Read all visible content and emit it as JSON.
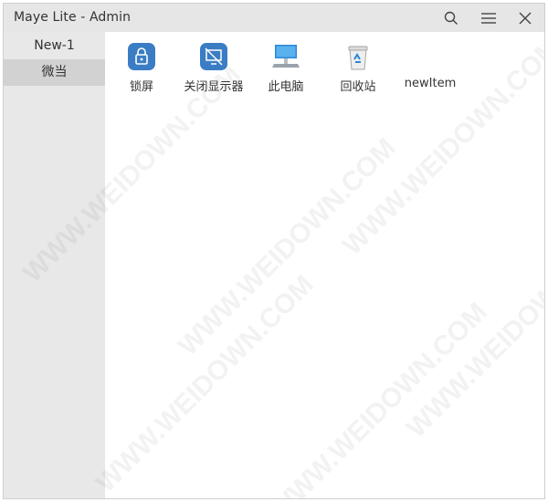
{
  "window": {
    "title": "Maye Lite - Admin"
  },
  "titlebar": {
    "icons": [
      "search-icon",
      "menu-icon",
      "close-icon"
    ]
  },
  "sidebar": {
    "items": [
      {
        "label": "New-1"
      },
      {
        "label": "微当"
      }
    ],
    "selected": "微当"
  },
  "apps": [
    {
      "label": "锁屏",
      "icon": "lock-icon"
    },
    {
      "label": "关闭显示器",
      "icon": "monitor-off-icon"
    },
    {
      "label": "此电脑",
      "icon": "computer-icon"
    },
    {
      "label": "回收站",
      "icon": "recycle-bin-icon"
    },
    {
      "label": "newItem",
      "icon": ""
    }
  ],
  "watermark": "WWW.WEIDOWN.COM",
  "colors": {
    "titlebar": "#e6e6e6",
    "sidebar": "#e8e8e8",
    "sidebar_active": "#d2d2d2",
    "tile_blue": "#3b7dc4"
  }
}
